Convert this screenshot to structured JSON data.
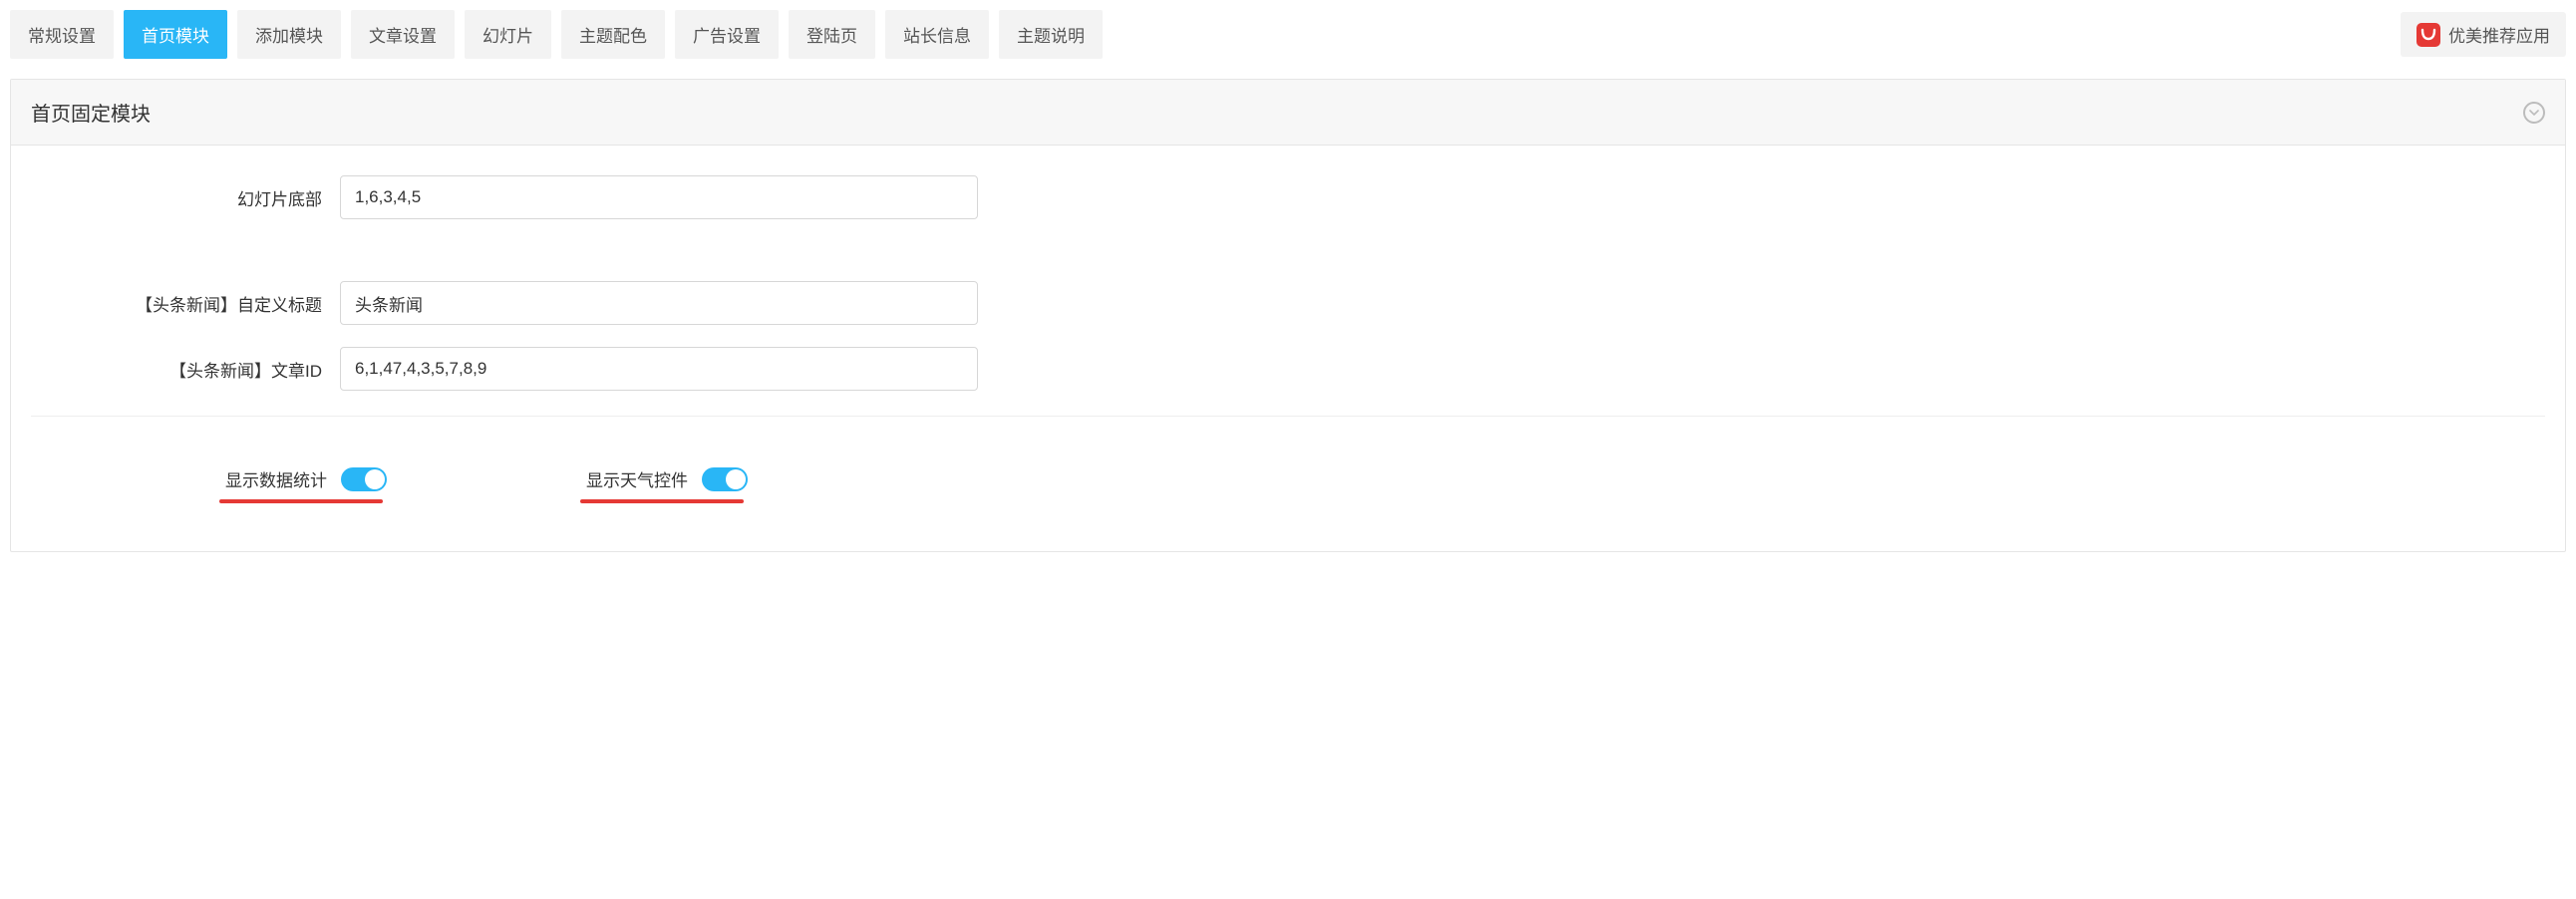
{
  "tabs": [
    {
      "label": "常规设置",
      "active": false
    },
    {
      "label": "首页模块",
      "active": true
    },
    {
      "label": "添加模块",
      "active": false
    },
    {
      "label": "文章设置",
      "active": false
    },
    {
      "label": "幻灯片",
      "active": false
    },
    {
      "label": "主题配色",
      "active": false
    },
    {
      "label": "广告设置",
      "active": false
    },
    {
      "label": "登陆页",
      "active": false
    },
    {
      "label": "站长信息",
      "active": false
    },
    {
      "label": "主题说明",
      "active": false
    }
  ],
  "promo": {
    "label": "优美推荐应用"
  },
  "panel": {
    "title": "首页固定模块"
  },
  "fields": {
    "slider_bottom": {
      "label": "幻灯片底部",
      "value": "1,6,3,4,5"
    },
    "headline_title": {
      "label": "【头条新闻】自定义标题",
      "value": "头条新闻"
    },
    "headline_ids": {
      "label": "【头条新闻】文章ID",
      "value": "6,1,47,4,3,5,7,8,9"
    }
  },
  "toggles": {
    "data_stats": {
      "label": "显示数据统计",
      "on": true
    },
    "weather_widget": {
      "label": "显示天气控件",
      "on": true
    }
  },
  "colors": {
    "accent": "#29b6f6",
    "danger": "#e53935"
  }
}
